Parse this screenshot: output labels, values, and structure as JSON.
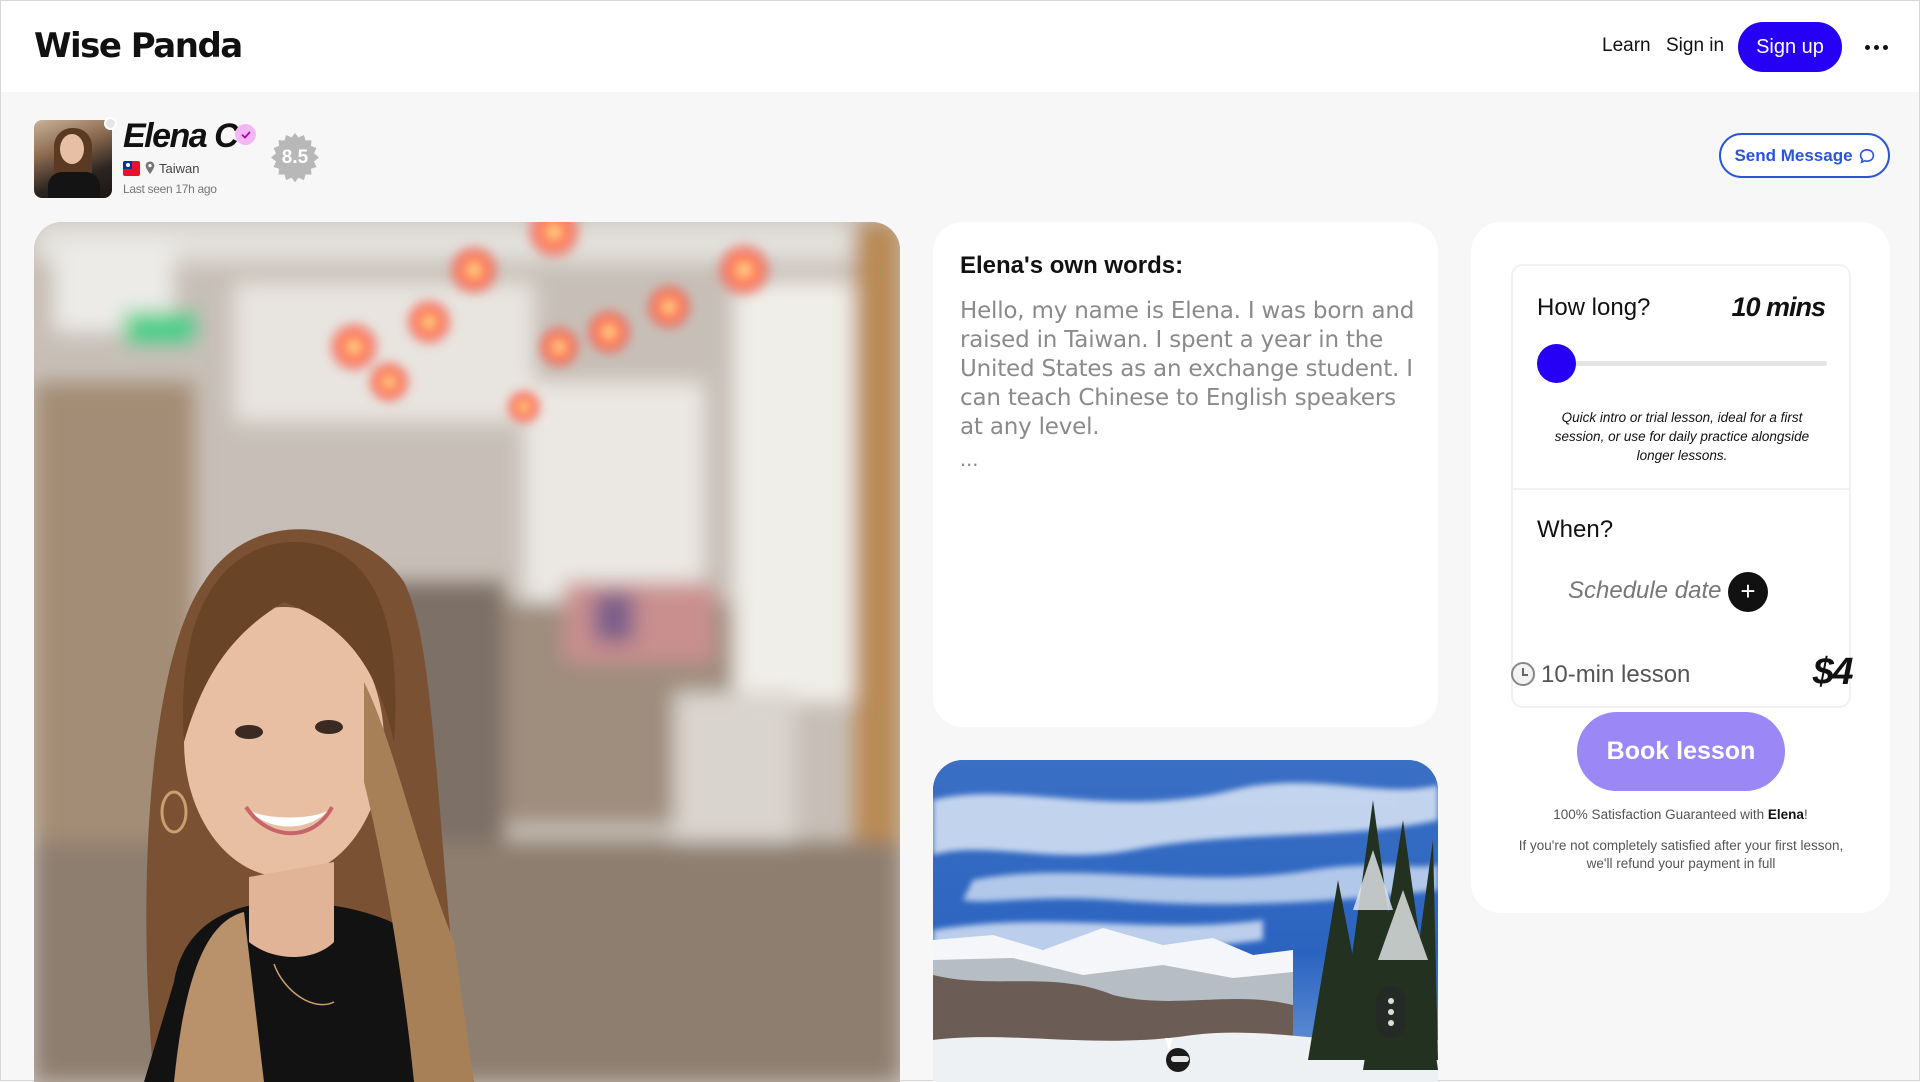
{
  "header": {
    "logo": "Wise Panda",
    "nav": {
      "learn": "Learn",
      "signin": "Sign in",
      "signup": "Sign up"
    }
  },
  "tutor": {
    "name": "Elena C",
    "country": "Taiwan",
    "last_seen": "Last seen 17h ago",
    "rating": "8.5",
    "send_message": "Send Message"
  },
  "about": {
    "title": "Elena's own words:",
    "text": "Hello, my name is Elena. I was born and raised in Taiwan. I spent a year in the United States as an exchange student. I can teach Chinese to English speakers at any level.",
    "ellipsis": "..."
  },
  "booking": {
    "how_long_label": "How long?",
    "duration_value": "10 mins",
    "slider_level": 0,
    "duration_description": "Quick intro or trial lesson, ideal for a first session, or use for daily practice alongside longer lessons.",
    "when_label": "When?",
    "schedule_placeholder": "Schedule date",
    "lesson_label": "10-min lesson",
    "price": "$4",
    "book_button": "Book lesson",
    "guarantee_prefix": "100% Satisfaction Guaranteed with ",
    "guarantee_name": "Elena",
    "guarantee_suffix": "!",
    "refund_text": "If you're not completely satisfied after your first lesson, we'll refund your payment in full"
  },
  "colors": {
    "accent": "#2600f5",
    "book_button": "#9b87f5",
    "message_border": "#2a55d6",
    "verified_badge": "#f3b8f3"
  },
  "icons": [
    "more-icon",
    "verified-icon",
    "flag-taiwan-icon",
    "location-pin-icon",
    "message-icon",
    "plus-icon",
    "clock-icon",
    "more-vertical-icon"
  ]
}
